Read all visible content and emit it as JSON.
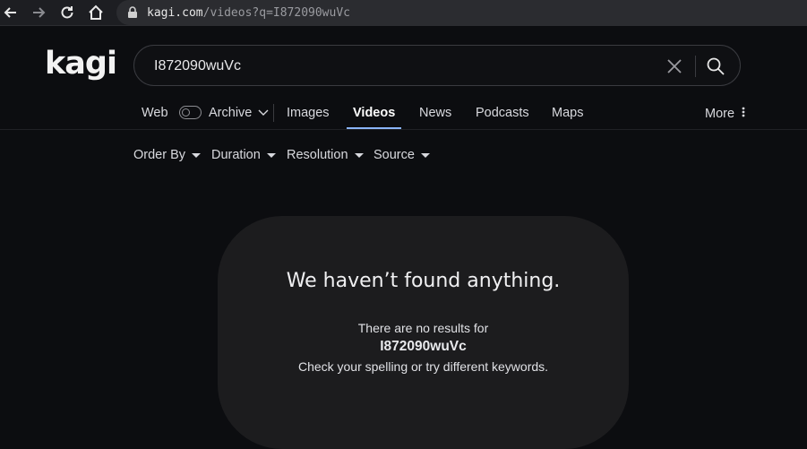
{
  "browser": {
    "url_host": "kagi.com",
    "url_path": "/videos?q=I872090wuVc"
  },
  "header": {
    "logo": "kagi",
    "search_value": "I872090wuVc"
  },
  "tabs": [
    {
      "label": "Web"
    },
    {
      "label": "Archive"
    },
    {
      "label": "Images"
    },
    {
      "label": "Videos",
      "active": true
    },
    {
      "label": "News"
    },
    {
      "label": "Podcasts"
    },
    {
      "label": "Maps"
    },
    {
      "label": "More"
    }
  ],
  "filters": [
    {
      "label": "Order By"
    },
    {
      "label": "Duration"
    },
    {
      "label": "Resolution"
    },
    {
      "label": "Source"
    }
  ],
  "empty_state": {
    "title": "We haven’t found anything.",
    "line1": "There are no results for",
    "query": "I872090wuVc",
    "line2": "Check your spelling or try different keywords."
  },
  "colors": {
    "background": "#0c0d10",
    "active_tab_underline": "#8ab4f8",
    "card": "#1c1c1e"
  }
}
